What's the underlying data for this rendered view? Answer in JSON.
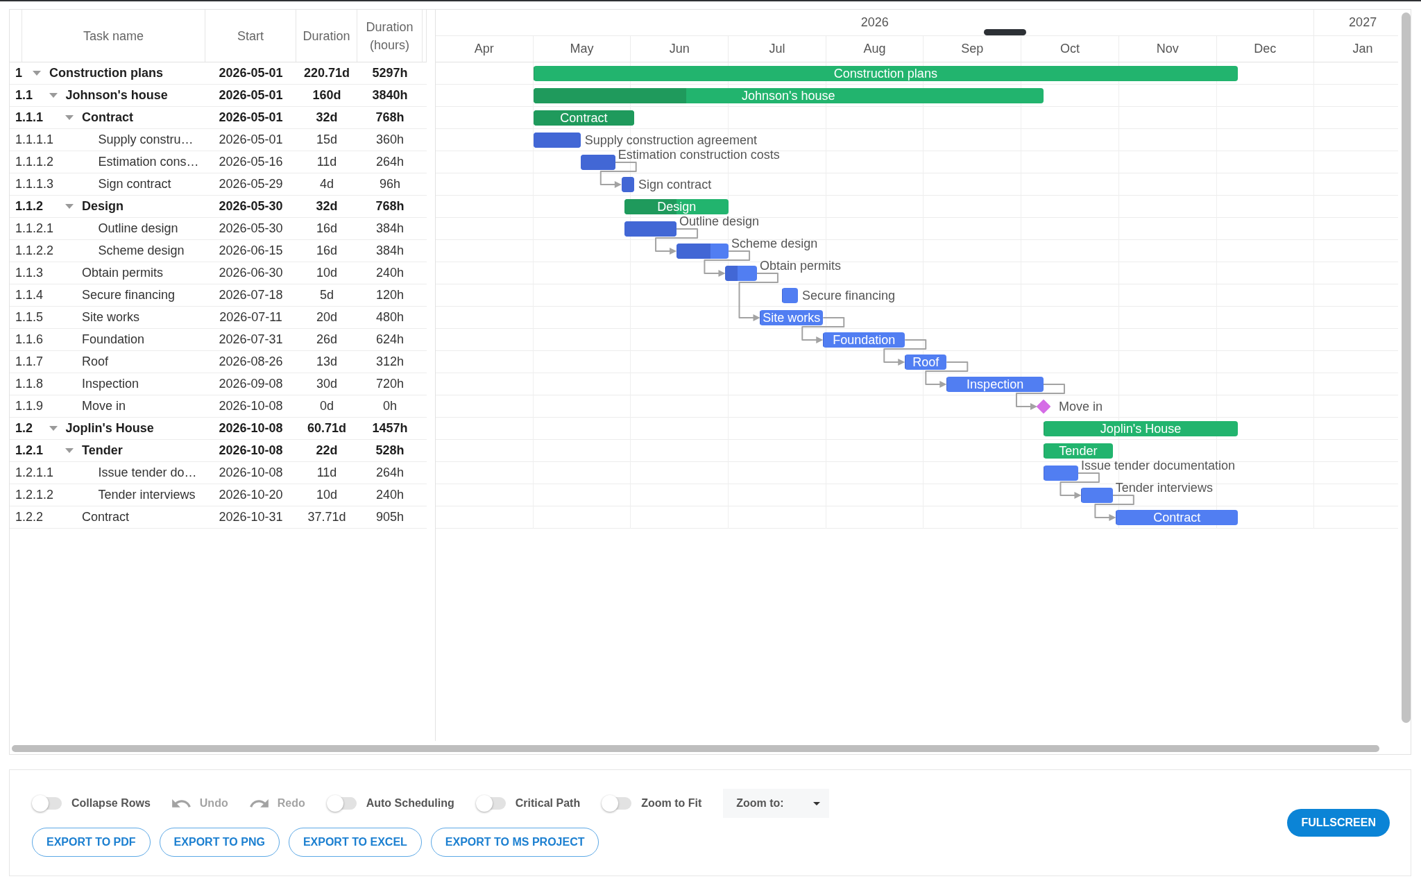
{
  "grid": {
    "columns": [
      {
        "label": "Task name"
      },
      {
        "label": "Start"
      },
      {
        "label": "Duration"
      },
      {
        "label": "Duration (hours)"
      }
    ]
  },
  "timeline": {
    "years": [
      {
        "label": "2026",
        "months": [
          "Apr",
          "May",
          "Jun",
          "Jul",
          "Aug",
          "Sep",
          "Oct",
          "Nov",
          "Dec"
        ]
      },
      {
        "label": "2027",
        "months": [
          "Jan"
        ]
      }
    ]
  },
  "tasks": [
    {
      "wbs": "1",
      "name": "Construction plans",
      "start": "2026-05-01",
      "duration": "220.71d",
      "hours": "5297h",
      "kind": "summary",
      "expanded": true,
      "level": 0,
      "bar_label": "Construction plans",
      "link_in": false,
      "link_out": false,
      "children": [
        {
          "wbs": "1.1",
          "name": "Johnson's house",
          "start": "2026-05-01",
          "duration": "160d",
          "hours": "3840h",
          "kind": "summary",
          "expanded": true,
          "level": 0.3,
          "bar_label": "Johnson's house",
          "link_in": false,
          "link_out": false,
          "children": [
            {
              "wbs": "1.1.1",
              "name": "Contract",
              "start": "2026-05-01",
              "duration": "32d",
              "hours": "768h",
              "kind": "summary",
              "expanded": true,
              "level": 1,
              "bar_label": "Contract",
              "link_in": false,
              "link_out": false,
              "children": [
                {
                  "wbs": "1.1.1.1",
                  "name": "Supply constru…",
                  "start": "2026-05-01",
                  "duration": "15d",
                  "hours": "360h",
                  "kind": "task",
                  "level": 1,
                  "bar_label": "Supply construction agreement",
                  "link_in": false,
                  "link_out": false
                },
                {
                  "wbs": "1.1.1.2",
                  "name": "Estimation cons…",
                  "start": "2026-05-16",
                  "duration": "11d",
                  "hours": "264h",
                  "kind": "task",
                  "level": 1,
                  "bar_label": "Estimation construction costs",
                  "link_in": false,
                  "link_out": true
                },
                {
                  "wbs": "1.1.1.3",
                  "name": "Sign contract",
                  "start": "2026-05-29",
                  "duration": "4d",
                  "hours": "96h",
                  "kind": "task",
                  "level": 1,
                  "bar_label": "Sign contract",
                  "link_in": true,
                  "link_out": false
                }
              ]
            },
            {
              "wbs": "1.1.2",
              "name": "Design",
              "start": "2026-05-30",
              "duration": "32d",
              "hours": "768h",
              "kind": "summary",
              "expanded": true,
              "level": 0.5,
              "bar_label": "Design",
              "link_in": false,
              "link_out": false,
              "children": [
                {
                  "wbs": "1.1.2.1",
                  "name": "Outline design",
                  "start": "2026-05-30",
                  "duration": "16d",
                  "hours": "384h",
                  "kind": "task",
                  "level": 1,
                  "bar_label": "Outline design",
                  "link_in": false,
                  "link_out": true
                },
                {
                  "wbs": "1.1.2.2",
                  "name": "Scheme design",
                  "start": "2026-06-15",
                  "duration": "16d",
                  "hours": "384h",
                  "kind": "task",
                  "level": 0.65,
                  "bar_label": "Scheme design",
                  "link_in": true,
                  "link_out": true
                }
              ]
            },
            {
              "wbs": "1.1.3",
              "name": "Obtain permits",
              "start": "2026-06-30",
              "duration": "10d",
              "hours": "240h",
              "kind": "task",
              "level": 0.38,
              "bar_label": "Obtain permits",
              "link_in": true,
              "link_out": true
            },
            {
              "wbs": "1.1.4",
              "name": "Secure financing",
              "start": "2026-07-18",
              "duration": "5d",
              "hours": "120h",
              "kind": "task",
              "level": 0,
              "bar_label": "Secure financing",
              "link_in": false,
              "link_out": false
            },
            {
              "wbs": "1.1.5",
              "name": "Site works",
              "start": "2026-07-11",
              "duration": "20d",
              "hours": "480h",
              "kind": "task",
              "level": 0,
              "bar_label": "Site works",
              "link_in": true,
              "link_out": true
            },
            {
              "wbs": "1.1.6",
              "name": "Foundation",
              "start": "2026-07-31",
              "duration": "26d",
              "hours": "624h",
              "kind": "task",
              "level": 0,
              "bar_label": "Foundation",
              "link_in": true,
              "link_out": true
            },
            {
              "wbs": "1.1.7",
              "name": "Roof",
              "start": "2026-08-26",
              "duration": "13d",
              "hours": "312h",
              "kind": "task",
              "level": 0,
              "bar_label": "Roof",
              "link_in": true,
              "link_out": true
            },
            {
              "wbs": "1.1.8",
              "name": "Inspection",
              "start": "2026-09-08",
              "duration": "30d",
              "hours": "720h",
              "kind": "task",
              "level": 0,
              "bar_label": "Inspection",
              "link_in": true,
              "link_out": true
            },
            {
              "wbs": "1.1.9",
              "name": "Move in",
              "start": "2026-10-08",
              "duration": "0d",
              "hours": "0h",
              "kind": "milestone",
              "bar_label": "Move in",
              "link_in": true,
              "link_out": false
            }
          ]
        },
        {
          "wbs": "1.2",
          "name": "Joplin's House",
          "start": "2026-10-08",
          "duration": "60.71d",
          "hours": "1457h",
          "kind": "summary",
          "expanded": true,
          "level": 0,
          "bar_label": "Joplin's House",
          "link_in": false,
          "link_out": false,
          "children": [
            {
              "wbs": "1.2.1",
              "name": "Tender",
              "start": "2026-10-08",
              "duration": "22d",
              "hours": "528h",
              "kind": "summary",
              "expanded": true,
              "level": 0,
              "bar_label": "Tender",
              "link_in": false,
              "link_out": false,
              "children": [
                {
                  "wbs": "1.2.1.1",
                  "name": "Issue tender do…",
                  "start": "2026-10-08",
                  "duration": "11d",
                  "hours": "264h",
                  "kind": "task",
                  "level": 0,
                  "bar_label": "Issue tender documentation",
                  "link_in": false,
                  "link_out": true
                },
                {
                  "wbs": "1.2.1.2",
                  "name": "Tender interviews",
                  "start": "2026-10-20",
                  "duration": "10d",
                  "hours": "240h",
                  "kind": "task",
                  "level": 0,
                  "bar_label": "Tender interviews",
                  "link_in": true,
                  "link_out": true
                }
              ]
            },
            {
              "wbs": "1.2.2",
              "name": "Contract",
              "start": "2026-10-31",
              "duration": "37.71d",
              "hours": "905h",
              "kind": "task",
              "level": 0,
              "bar_label": "Contract",
              "link_in": true,
              "link_out": false
            }
          ]
        }
      ]
    }
  ],
  "toolbar": {
    "controls": [
      {
        "kind": "toggle",
        "label": "Collapse Rows",
        "on": false
      },
      {
        "kind": "undo",
        "label": "Undo",
        "disabled": true
      },
      {
        "kind": "redo",
        "label": "Redo",
        "disabled": true
      },
      {
        "kind": "toggle",
        "label": "Auto Scheduling",
        "on": false
      },
      {
        "kind": "toggle",
        "label": "Critical Path",
        "on": false
      },
      {
        "kind": "toggle",
        "label": "Zoom to Fit",
        "on": false
      },
      {
        "kind": "select",
        "label": "Zoom to:"
      }
    ],
    "exports": [
      {
        "label": "EXPORT TO PDF"
      },
      {
        "label": "EXPORT TO PNG"
      },
      {
        "label": "EXPORT TO EXCEL"
      },
      {
        "label": "EXPORT TO MS PROJECT"
      }
    ],
    "fullscreen": {
      "label": "FULLSCREEN"
    }
  }
}
